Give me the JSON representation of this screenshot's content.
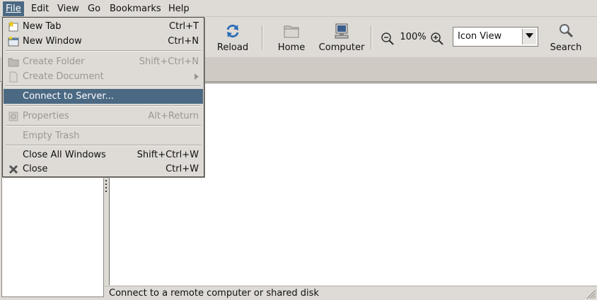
{
  "menubar": {
    "items": [
      {
        "label": "File",
        "mnemonic": "F"
      },
      {
        "label": "Edit",
        "mnemonic": "E"
      },
      {
        "label": "View",
        "mnemonic": "V"
      },
      {
        "label": "Go",
        "mnemonic": "G"
      },
      {
        "label": "Bookmarks",
        "mnemonic": "B"
      },
      {
        "label": "Help",
        "mnemonic": "H"
      }
    ],
    "active": "File"
  },
  "toolbar": {
    "reload_label": "Reload",
    "home_label": "Home",
    "computer_label": "Computer",
    "zoom_level": "100%",
    "view_mode": "Icon View",
    "search_label": "Search",
    "icons": {
      "reload": "reload-icon",
      "home": "folder-home-icon",
      "computer": "computer-icon",
      "zoom_out": "zoom-out-icon",
      "zoom_in": "zoom-in-icon",
      "search": "search-icon"
    }
  },
  "file_menu": {
    "new_tab": {
      "label": "New Tab",
      "shortcut": "Ctrl+T"
    },
    "new_window": {
      "label": "New Window",
      "shortcut": "Ctrl+N"
    },
    "create_folder": {
      "label": "Create Folder",
      "shortcut": "Shift+Ctrl+N"
    },
    "create_document": {
      "label": "Create Document"
    },
    "connect_to_server": {
      "label": "Connect to Server..."
    },
    "properties": {
      "label": "Properties",
      "shortcut": "Alt+Return"
    },
    "empty_trash": {
      "label": "Empty Trash"
    },
    "close_all_windows": {
      "label": "Close All Windows",
      "shortcut": "Shift+Ctrl+W"
    },
    "close": {
      "label": "Close",
      "shortcut": "Ctrl+W"
    }
  },
  "statusbar": {
    "text": "Connect to a remote computer or shared disk"
  },
  "colors": {
    "highlight": "#4b6983",
    "window_bg": "#dedbd6",
    "disabled_text": "#9a968f"
  }
}
